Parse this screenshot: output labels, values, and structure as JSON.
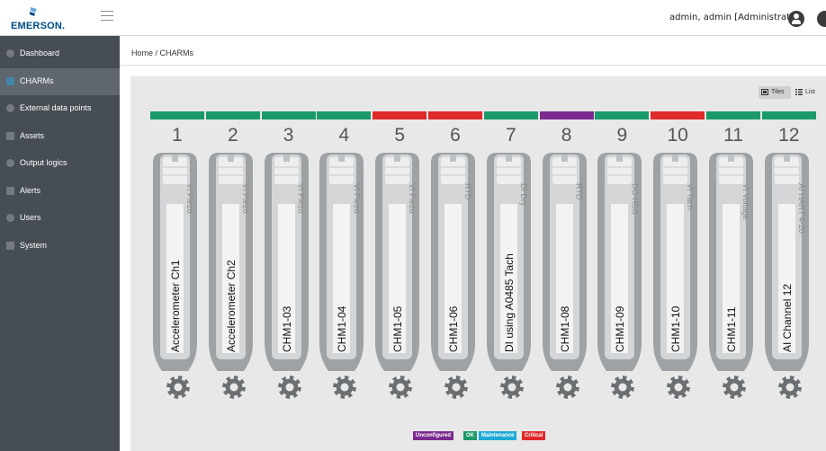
{
  "header": {
    "logo_text": "EMERSON.",
    "user": "admin, admin [Administrator]"
  },
  "sidebar": {
    "items": [
      {
        "label": "Dashboard",
        "icon": "dashboard-icon",
        "active": false
      },
      {
        "label": "CHARMs",
        "icon": "charms-icon",
        "active": true
      },
      {
        "label": "External data points",
        "icon": "external-data-icon",
        "active": false
      },
      {
        "label": "Assets",
        "icon": "assets-icon",
        "active": false
      },
      {
        "label": "Output logics",
        "icon": "output-logics-icon",
        "active": false
      },
      {
        "label": "Alerts",
        "icon": "alerts-icon",
        "active": false
      },
      {
        "label": "Users",
        "icon": "users-icon",
        "active": false
      },
      {
        "label": "System",
        "icon": "system-icon",
        "active": false
      }
    ]
  },
  "breadcrumb": "Home  /  CHARMs",
  "view_toggle": {
    "tiles": "Tiles",
    "list": "List"
  },
  "colors": {
    "unconfigured": "#7b2a8f",
    "ok": "#1a9a68",
    "maintenance": "#1fa9d6",
    "critical": "#e02a2a"
  },
  "charms": [
    {
      "num": "1",
      "name": "Accelerometer Ch1",
      "type": "VI Piezo",
      "status": "ok"
    },
    {
      "num": "2",
      "name": "Accelerometer Ch2",
      "type": "VI Piezo",
      "status": "ok"
    },
    {
      "num": "3",
      "name": "CHM1-03",
      "type": "VI Piezo",
      "status": "ok"
    },
    {
      "num": "4",
      "name": "CHM1-04",
      "type": "VI Piezo",
      "status": "ok"
    },
    {
      "num": "5",
      "name": "CHM1-05",
      "type": "VI Piezo",
      "status": "critical"
    },
    {
      "num": "6",
      "name": "CHM1-06",
      "type": "RTD",
      "status": "critical"
    },
    {
      "num": "7",
      "name": "DI using A0485 Tach",
      "type": "DI Dry",
      "status": "ok"
    },
    {
      "num": "8",
      "name": "CHM1-08",
      "type": "RTD",
      "status": "unconfigured"
    },
    {
      "num": "9",
      "name": "CHM1-09",
      "type": "DO HSS",
      "status": "ok"
    },
    {
      "num": "10",
      "name": "CHM1-10",
      "type": "VI Tach",
      "status": "critical"
    },
    {
      "num": "11",
      "name": "CHM1-11",
      "type": "VI Voltage",
      "status": "ok"
    },
    {
      "num": "12",
      "name": "AI Channel 12",
      "type": "AI HART 4-20",
      "status": "ok"
    }
  ],
  "legend": [
    {
      "label": "Unconfigured",
      "key": "unconfigured"
    },
    {
      "label": "OK",
      "key": "ok"
    },
    {
      "label": "Maintenance",
      "key": "maintenance"
    },
    {
      "label": "Critical",
      "key": "critical"
    }
  ]
}
